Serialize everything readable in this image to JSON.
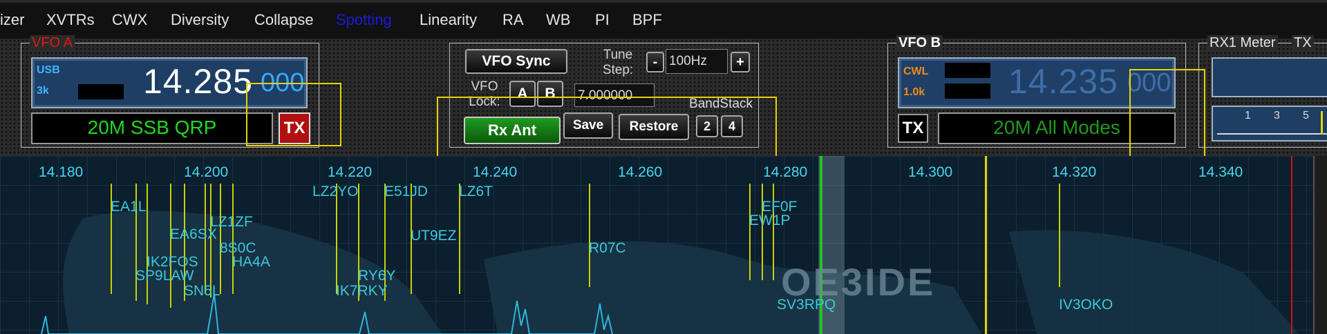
{
  "menu": [
    "izer",
    "XVTRs",
    "CWX",
    "Diversity",
    "Collapse",
    "Spotting",
    "Linearity",
    "RA",
    "WB",
    "PI",
    "BPF"
  ],
  "vfo_a": {
    "title": "VFO A",
    "mode": "USB",
    "filter": "3k",
    "freq_main": "14.285",
    "freq_sub": "000",
    "name": "20M SSB QRP",
    "tx_label": "TX"
  },
  "center": {
    "vfo_sync_label": "VFO Sync",
    "tune_step_label": "Tune Step:",
    "step_minus": "-",
    "step_value": "100Hz",
    "step_plus": "+",
    "vfo_lock_label": "VFO Lock:",
    "lock_a": "A",
    "lock_b": "B",
    "freq_input": "7.000000",
    "bandstack_label": "BandStack",
    "rx_ant_label": "Rx Ant",
    "save_label": "Save",
    "restore_label": "Restore",
    "bandstack_num1": "2",
    "bandstack_num2": "4"
  },
  "vfo_b": {
    "title": "VFO B",
    "mode": "CWL",
    "filter": "1.0k",
    "freq_main": "14.235",
    "freq_sub": "000",
    "name": "20M All Modes",
    "tx_label": "TX"
  },
  "rx1_meter": {
    "title": "RX1 Meter",
    "tx_label": "TX",
    "scale": [
      "1",
      "3",
      "5"
    ]
  },
  "spectrum": {
    "ticks": [
      "14.180",
      "14.200",
      "14.220",
      "14.240",
      "14.260",
      "14.280",
      "14.300",
      "14.320",
      "14.340"
    ],
    "spots": [
      "EA1L",
      "LZ2YO",
      "E51JD",
      "LZ6T",
      "EF0F",
      "EW1P",
      "LZ1ZF",
      "EA6SX",
      "8S0C",
      "UT9EZ",
      "R07C",
      "IK2FOS",
      "HA4A",
      "SP9LAW",
      "RY6Y",
      "SN5L",
      "IK7RKY",
      "SV3RPQ",
      "IV3OKO"
    ],
    "watermark": "OE3IDE",
    "colors": {
      "tick": "#45d6ee",
      "spot_line": "#c9d200",
      "vfo_a_marker": "#22c422",
      "vfo_b_marker": "#e6d400",
      "edge_marker": "#d01010"
    }
  },
  "colors": {
    "vfo_a_title": "#e01818",
    "freq_bright": "#ffffff",
    "freq_dim": "#3e6ea8",
    "sub_bright": "#38a8ff",
    "mode_green": "#20d820",
    "mode_dim_green": "#1f9a1f",
    "highlight": "#e6d400"
  }
}
